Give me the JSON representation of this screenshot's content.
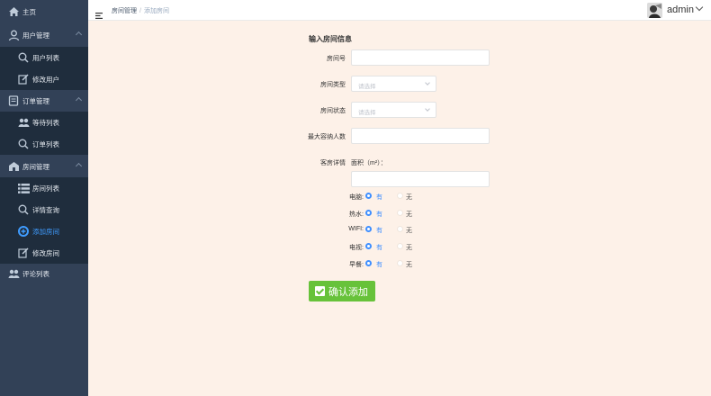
{
  "sidebar": {
    "items": [
      {
        "label": "主页",
        "icon": "home-icon"
      },
      {
        "label": "用户管理",
        "icon": "user-icon"
      },
      {
        "label": "用户列表",
        "icon": "search-icon"
      },
      {
        "label": "修改用户",
        "icon": "edit-icon"
      },
      {
        "label": "订单管理",
        "icon": "order-icon"
      },
      {
        "label": "等待列表",
        "icon": "group-icon"
      },
      {
        "label": "订单列表",
        "icon": "search-icon"
      },
      {
        "label": "房间管理",
        "icon": "room-icon"
      },
      {
        "label": "房间列表",
        "icon": "list-icon"
      },
      {
        "label": "详情查询",
        "icon": "search-icon"
      },
      {
        "label": "添加房间",
        "icon": "add-icon"
      },
      {
        "label": "修改房间",
        "icon": "edit-icon"
      },
      {
        "label": "评论列表",
        "icon": "group-icon"
      }
    ]
  },
  "header": {
    "breadcrumb": [
      "房间管理",
      "添加房间"
    ],
    "separator": "/",
    "username": "admin"
  },
  "form": {
    "title": "输入房间信息",
    "room_number_label": "房间号",
    "room_type_label": "房间类型",
    "room_type_placeholder": "请选择",
    "room_status_label": "房间状态",
    "room_status_placeholder": "请选择",
    "max_people_label": "最大容纳人数",
    "details_label": "客房详情",
    "area_label": "面积（m²）：",
    "amenities": [
      {
        "label": "电脑:",
        "yes": "有",
        "no": "无",
        "selected": "yes"
      },
      {
        "label": "热水:",
        "yes": "有",
        "no": "无",
        "selected": "yes"
      },
      {
        "label": "WIFI:",
        "yes": "有",
        "no": "无",
        "selected": "yes"
      },
      {
        "label": "电视:",
        "yes": "有",
        "no": "无",
        "selected": "yes"
      },
      {
        "label": "早餐:",
        "yes": "有",
        "no": "无",
        "selected": "yes"
      }
    ],
    "confirm_label": "确认添加"
  },
  "colors": {
    "sidebar_bg": "#324157",
    "submenu_bg": "#1f2d3d",
    "active": "#3f9cff",
    "page_bg": "#fdf1e8",
    "confirm_bg": "#67c23a"
  }
}
